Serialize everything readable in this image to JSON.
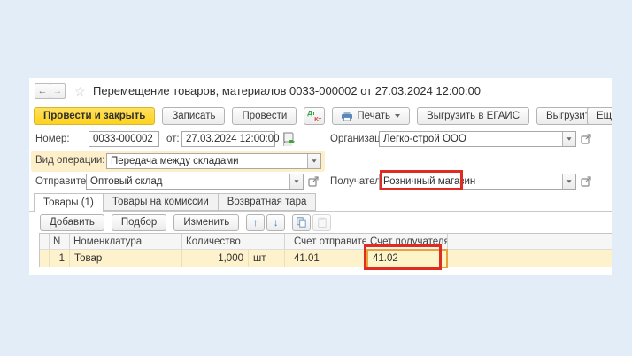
{
  "window": {
    "title": "Перемещение товаров, материалов 0033-000002 от 27.03.2024 12:00:00"
  },
  "icons": {
    "nav_back": "←",
    "nav_forward": "→",
    "favorite": "☆",
    "move_up": "↑",
    "move_down": "↓"
  },
  "toolbar": {
    "post_and_close": "Провести и закрыть",
    "save": "Записать",
    "post": "Провести",
    "dt": "Дт",
    "kt": "Кт",
    "print": "Печать",
    "upload_egais": "Выгрузить в ЕГАИС",
    "upload_vetis": "Выгрузить в ВЕТИС",
    "more": "Ещё"
  },
  "form": {
    "number_label": "Номер:",
    "number_value": "0033-000002",
    "date_label": "от:",
    "date_value": "27.03.2024 12:00:00",
    "org_label": "Организация:",
    "org_value": "Легко-строй ООО",
    "operation_label": "Вид операции:",
    "operation_value": "Передача между складами",
    "sender_label": "Отправитель:",
    "sender_value": "Оптовый склад",
    "receiver_label": "Получатель:",
    "receiver_value": "Розничный магазин"
  },
  "tabs": [
    {
      "label": "Товары (1)",
      "active": true
    },
    {
      "label": "Товары на комиссии",
      "active": false
    },
    {
      "label": "Возвратная тара",
      "active": false
    }
  ],
  "items_toolbar": {
    "add": "Добавить",
    "pick": "Подбор",
    "edit": "Изменить"
  },
  "items_table": {
    "columns": {
      "n": "N",
      "item": "Номенклатура",
      "qty": "Количество",
      "acc_sender": "Счет отправителя",
      "acc_receiver": "Счет получателя"
    },
    "rows": [
      {
        "n": "1",
        "item": "Товар",
        "qty": "1,000",
        "unit": "шт",
        "acc_sender": "41.01",
        "acc_receiver": "41.02"
      }
    ]
  },
  "colors": {
    "background": "#e3edf8",
    "accent_button": "#ffd633",
    "annotation_red": "#e02b20",
    "row_highlight": "#fdf2cc",
    "focused_cell_border": "#e9a23b",
    "operation_highlight": "#fcefc9"
  }
}
